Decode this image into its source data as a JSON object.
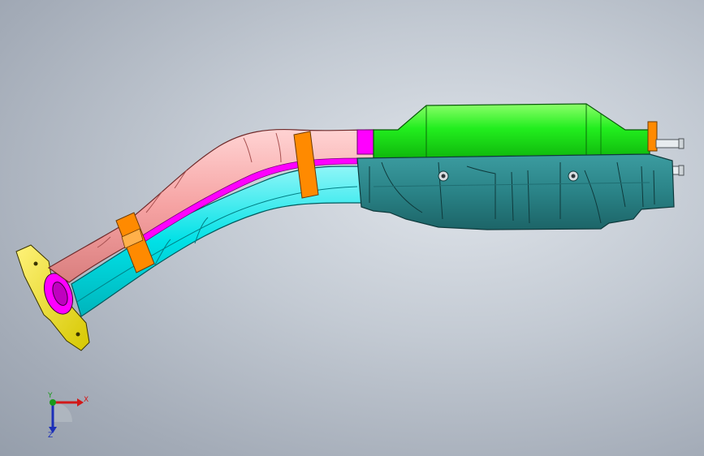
{
  "viewport": {
    "background_top": "#dfe4ea",
    "background_bottom": "#959eab"
  },
  "model": {
    "part_colors": {
      "flange": "#f2e600",
      "upper_pipe": "#f6a3a3",
      "lower_pipe": "#00e1e6",
      "seam": "#ff00ff",
      "clamp": "#ff8a00",
      "converter": "#1ee61e",
      "heat_shield": "#2f8b8f",
      "fittings": "#e7ecef"
    }
  },
  "triad": {
    "x_label": "X",
    "y_label": "Y",
    "z_label": "Z",
    "x_color": "#d21818",
    "y_color": "#1a9a1a",
    "z_color": "#1b2fb8"
  }
}
